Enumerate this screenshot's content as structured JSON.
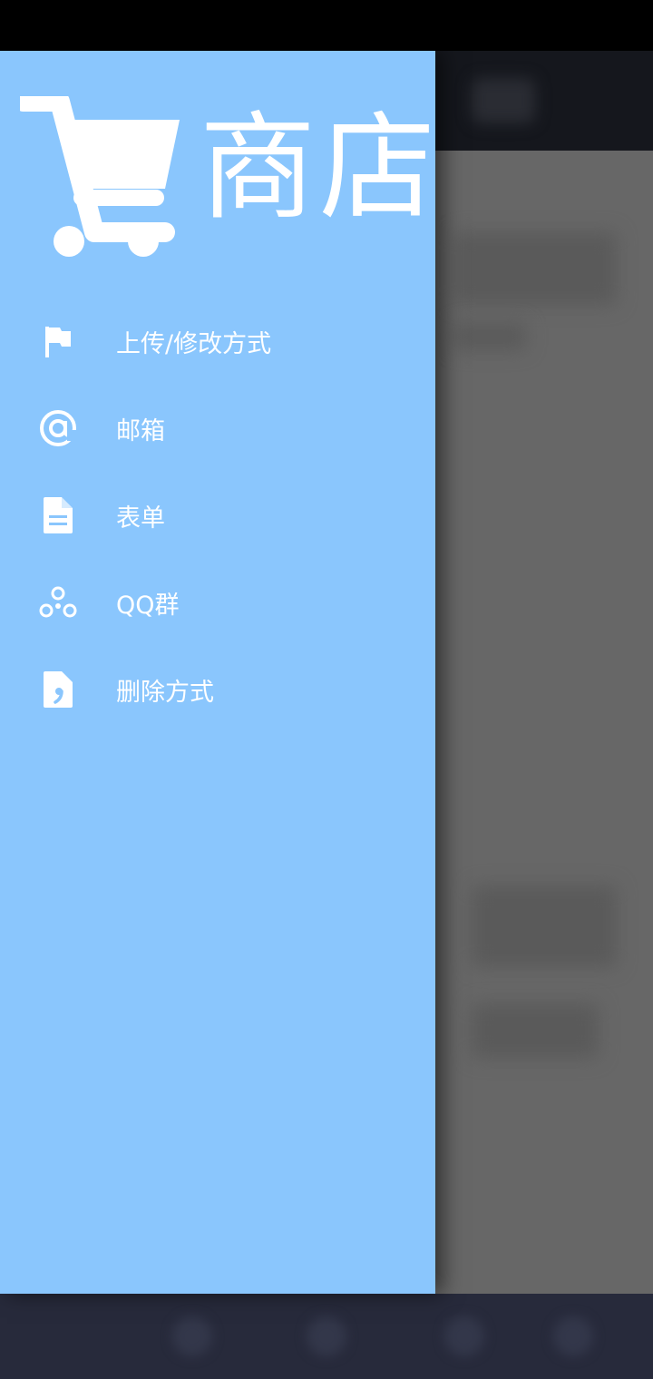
{
  "drawer": {
    "title": "商店",
    "logo_icon": "shopping-cart-icon",
    "background_color": "#8ac6fd",
    "items": [
      {
        "label": "上传/修改方式",
        "icon": "flag-icon"
      },
      {
        "label": "邮箱",
        "icon": "at-sign-icon"
      },
      {
        "label": "表单",
        "icon": "document-icon"
      },
      {
        "label": "QQ群",
        "icon": "group-circles-icon"
      },
      {
        "label": "删除方式",
        "icon": "quote-document-icon"
      }
    ]
  },
  "colors": {
    "drawer_bg": "#8ac6fd",
    "scrim": "#676767",
    "status_bar": "#000000",
    "nav_bar": "#272a3b",
    "text": "#ffffff"
  }
}
